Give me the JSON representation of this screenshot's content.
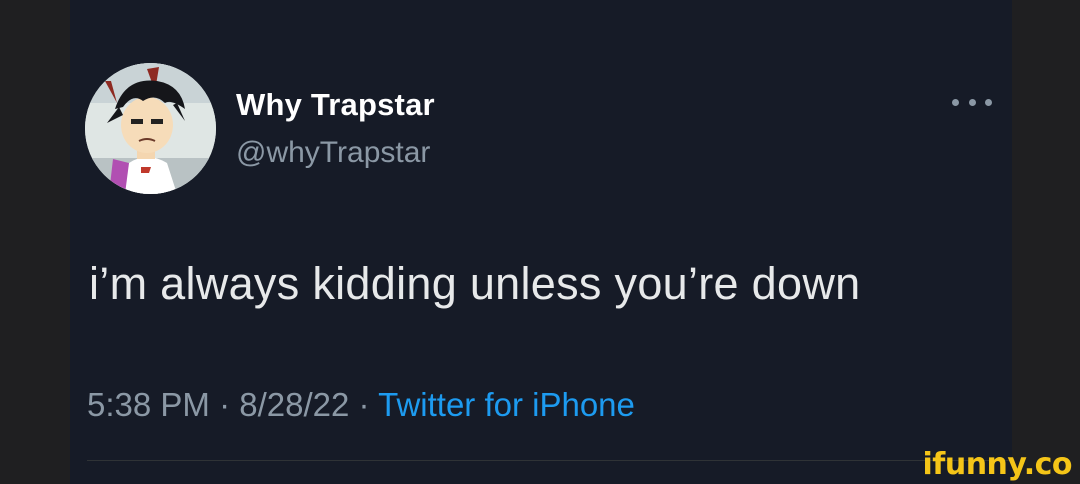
{
  "tweet": {
    "author": {
      "display_name": "Why Trapstar",
      "handle": "@whyTrapstar",
      "avatar": "cartoon-boy-avatar"
    },
    "more_icon": "more-dots-icon",
    "text": "i’m always kidding unless you’re down",
    "time": "5:38 PM",
    "separator": "·",
    "date": "8/28/22",
    "source": "Twitter for iPhone"
  },
  "watermark": "ifunny.co",
  "colors": {
    "background": "#161b27",
    "text": "#e7e9ea",
    "muted": "#8b98a5",
    "link": "#1d9bf0",
    "watermark": "#f5c518"
  }
}
